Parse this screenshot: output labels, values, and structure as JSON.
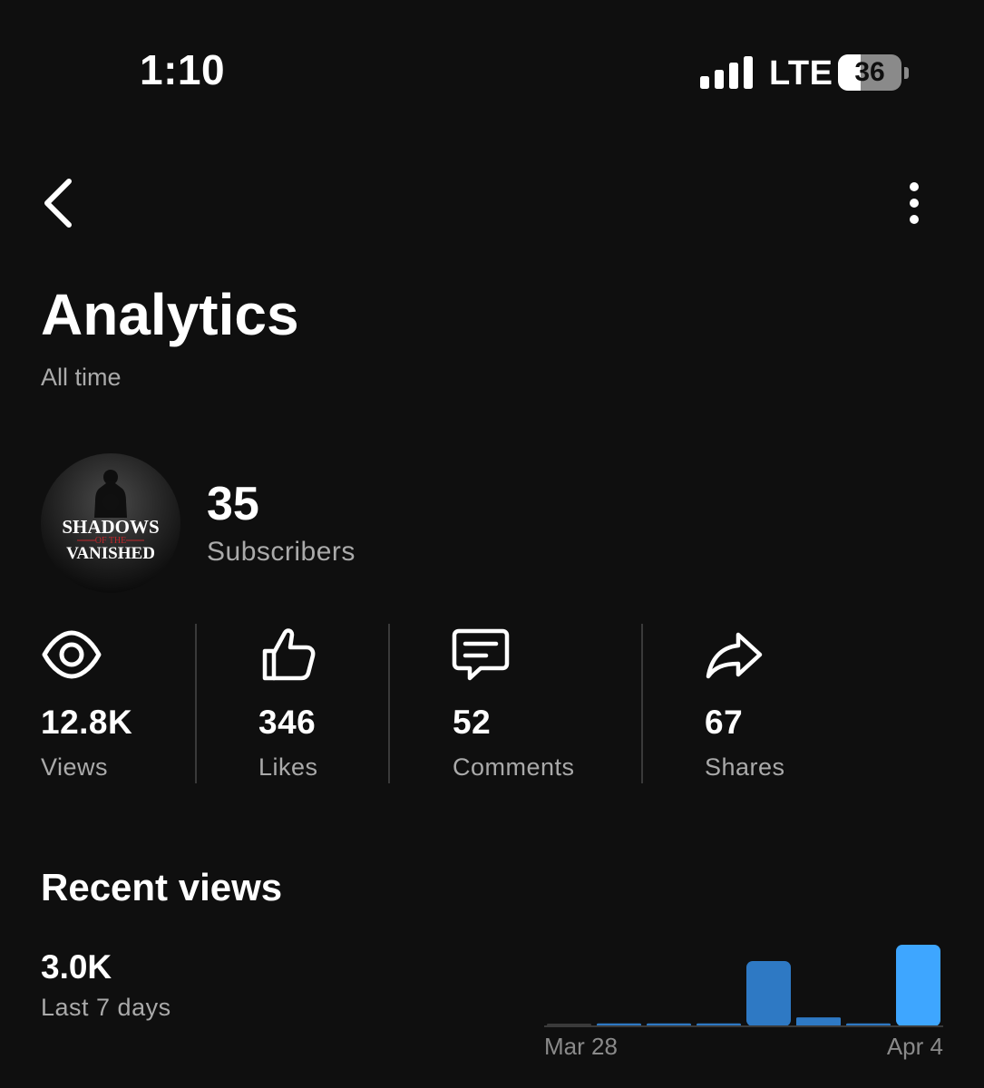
{
  "status_bar": {
    "time": "1:10",
    "carrier": "LTE",
    "battery_level": 36,
    "battery_text": "36"
  },
  "header": {
    "title": "Analytics",
    "range": "All time"
  },
  "channel": {
    "logo_text": [
      "SHADOWS",
      "OF THE",
      "VANISHED"
    ],
    "subscribers_count": "35",
    "subscribers_label": "Subscribers"
  },
  "metrics": [
    {
      "icon": "eye-icon",
      "value": "12.8K",
      "label": "Views"
    },
    {
      "icon": "thumbs-up-icon",
      "value": "346",
      "label": "Likes"
    },
    {
      "icon": "comment-icon",
      "value": "52",
      "label": "Comments"
    },
    {
      "icon": "share-icon",
      "value": "67",
      "label": "Shares"
    }
  ],
  "recent": {
    "title": "Recent views",
    "value": "3.0K",
    "label": "Last 7 days"
  },
  "chart_data": {
    "type": "bar",
    "x_start_label": "Mar 28",
    "x_end_label": "Apr 4",
    "values": [
      2,
      18,
      18,
      18,
      400,
      55,
      18,
      500
    ],
    "colors": {
      "inactive": "#3a3a3a",
      "bar": "#2e79c4",
      "latest": "#3ea6ff"
    },
    "ylim": [
      0,
      500
    ]
  }
}
